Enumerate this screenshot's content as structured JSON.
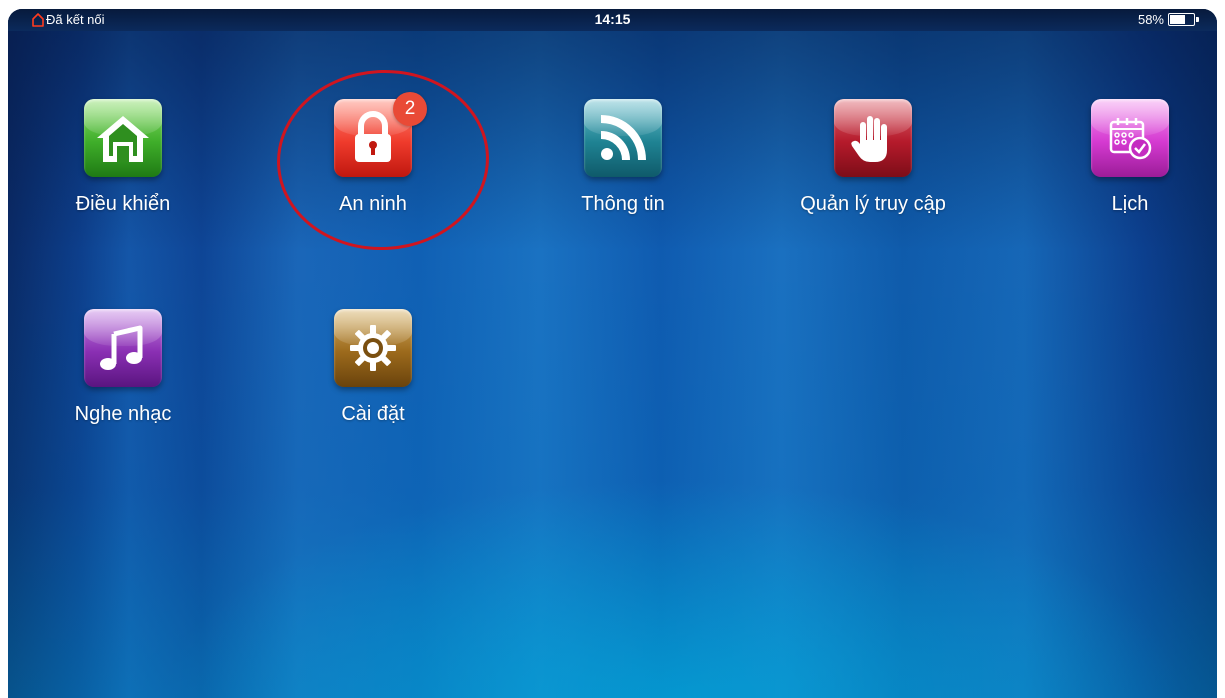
{
  "status_bar": {
    "connection_icon": "home-outline-icon",
    "connection_text": "Đã kết nối",
    "time": "14:15",
    "battery_text": "58%",
    "battery_level": 0.58
  },
  "apps": [
    {
      "label": "Điều khiển",
      "icon": "home-icon",
      "color": "#3fae2a"
    },
    {
      "label": "An ninh",
      "icon": "padlock-icon",
      "color": "#ef3b2c",
      "badge": "2"
    },
    {
      "label": "Thông tin",
      "icon": "rss-feed-icon",
      "color": "#1f8393"
    },
    {
      "label": "Quản lý truy cập",
      "icon": "hand-stop-icon",
      "color": "#b51a2b"
    },
    {
      "label": "Lịch",
      "icon": "calendar-clock-icon",
      "color": "#d53ad1"
    },
    {
      "label": "Nghe nhạc",
      "icon": "music-note-icon",
      "color": "#8a2fb3"
    },
    {
      "label": "Cài đặt",
      "icon": "gear-icon",
      "color": "#9c6a1c"
    }
  ],
  "annotation_color": "#d0151f"
}
